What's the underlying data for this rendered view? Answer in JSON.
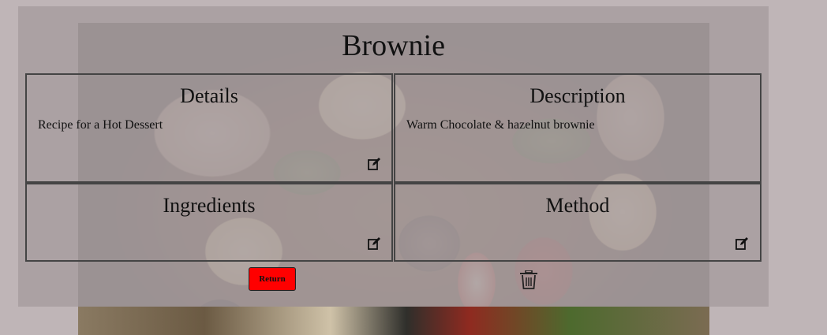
{
  "recipe": {
    "title": "Brownie"
  },
  "cards": {
    "details": {
      "heading": "Details",
      "text": "Recipe for a Hot Dessert"
    },
    "description": {
      "heading": "Description",
      "text": "Warm Chocolate & hazelnut brownie"
    },
    "ingredients": {
      "heading": "Ingredients",
      "text": ""
    },
    "method": {
      "heading": "Method",
      "text": ""
    }
  },
  "actions": {
    "return_label": "Return"
  },
  "icons": {
    "edit": "edit-icon",
    "delete": "trash-icon"
  },
  "colors": {
    "page_background": "#bfb5b7",
    "panel_overlay": "#a89ea0",
    "return_button": "#ff0000",
    "card_border": "#444444"
  }
}
